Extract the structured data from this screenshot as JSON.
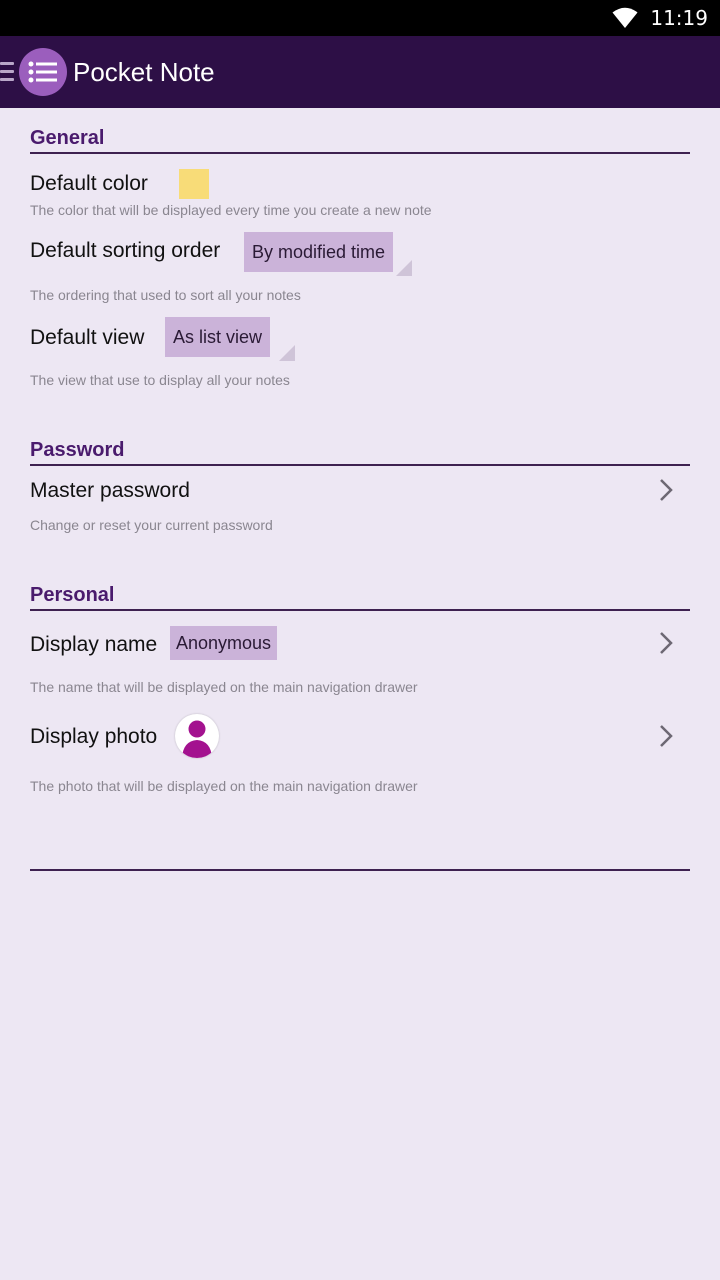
{
  "status_bar": {
    "time": "11:19",
    "wifi_icon": "wifi-icon"
  },
  "app_bar": {
    "title": "Pocket Note",
    "logo_icon": "list-icon",
    "menu_icon": "hamburger-icon",
    "color": "#2d0f46"
  },
  "sections": {
    "general": {
      "header": "General",
      "default_color": {
        "title": "Default color",
        "summary": "The color that will be displayed every time you create a new note",
        "value_color": "#f8dc78"
      },
      "default_sorting": {
        "title": "Default sorting order",
        "value": "By modified time",
        "summary": "The ordering that used to sort all your notes"
      },
      "default_view": {
        "title": "Default view",
        "value": "As list view",
        "summary": "The view that use to display all your notes"
      }
    },
    "password": {
      "header": "Password",
      "master_password": {
        "title": "Master password",
        "summary": "Change or reset your current password"
      }
    },
    "personal": {
      "header": "Personal",
      "display_name": {
        "title": "Display name",
        "value": "Anonymous",
        "summary": "The name that will be displayed on the main navigation drawer"
      },
      "display_photo": {
        "title": "Display photo",
        "summary": "The photo that will be displayed on the main navigation drawer"
      }
    }
  },
  "colors": {
    "accent": "#4a1b6d",
    "background": "#ede7f3",
    "spinner": "#cbb3d9"
  }
}
